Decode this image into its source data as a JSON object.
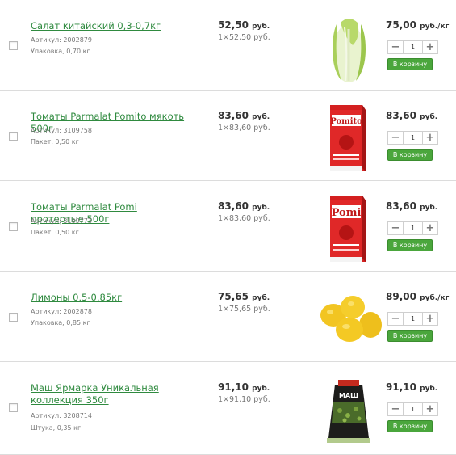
{
  "products": [
    {
      "title": "Салат китайский 0,3-0,7кг",
      "article": "Артикул: 2002879",
      "pack": "Упаковка, 0,70 кг",
      "price": "52,50",
      "currency": "руб.",
      "subprice": "1×52,50 руб.",
      "unit_price": "75,00",
      "unit_currency": "руб./кг",
      "quantity": "1",
      "cart_label": "В корзину",
      "image": "napa-cabbage-icon"
    },
    {
      "title": "Томаты Parmalat Pomito мякоть 500г",
      "article": "Артикул: 3109758",
      "pack": "Пакет, 0,50 кг",
      "price": "83,60",
      "currency": "руб.",
      "subprice": "1×83,60 руб.",
      "unit_price": "83,60",
      "unit_currency": "руб.",
      "quantity": "1",
      "cart_label": "В корзину",
      "image": "pomito-pack-icon",
      "pack_brand": "Pomito"
    },
    {
      "title": "Томаты Parmalat Pomi протертые 500г",
      "article": "Артикул: 3109773",
      "pack": "Пакет, 0,50 кг",
      "price": "83,60",
      "currency": "руб.",
      "subprice": "1×83,60 руб.",
      "unit_price": "83,60",
      "unit_currency": "руб.",
      "quantity": "1",
      "cart_label": "В корзину",
      "image": "pomi-pack-icon",
      "pack_brand": "Pomi"
    },
    {
      "title": "Лимоны 0,5-0,85кг",
      "article": "Артикул: 2002878",
      "pack": "Упаковка, 0,85 кг",
      "price": "75,65",
      "currency": "руб.",
      "subprice": "1×75,65 руб.",
      "unit_price": "89,00",
      "unit_currency": "руб./кг",
      "quantity": "1",
      "cart_label": "В корзину",
      "image": "lemons-icon"
    },
    {
      "title": "Маш Ярмарка Уникальная коллекция 350г",
      "article": "Артикул: 3208714",
      "pack": "Штука, 0,35 кг",
      "price": "91,10",
      "currency": "руб.",
      "subprice": "1×91,10 руб.",
      "unit_price": "91,10",
      "unit_currency": "руб.",
      "quantity": "1",
      "cart_label": "В корзину",
      "image": "mung-bean-pack-icon",
      "pack_brand": "МАШ"
    }
  ],
  "colors": {
    "link": "#2f8a3f",
    "cart_button": "#4aa63c",
    "divider": "#dcdcdc"
  }
}
